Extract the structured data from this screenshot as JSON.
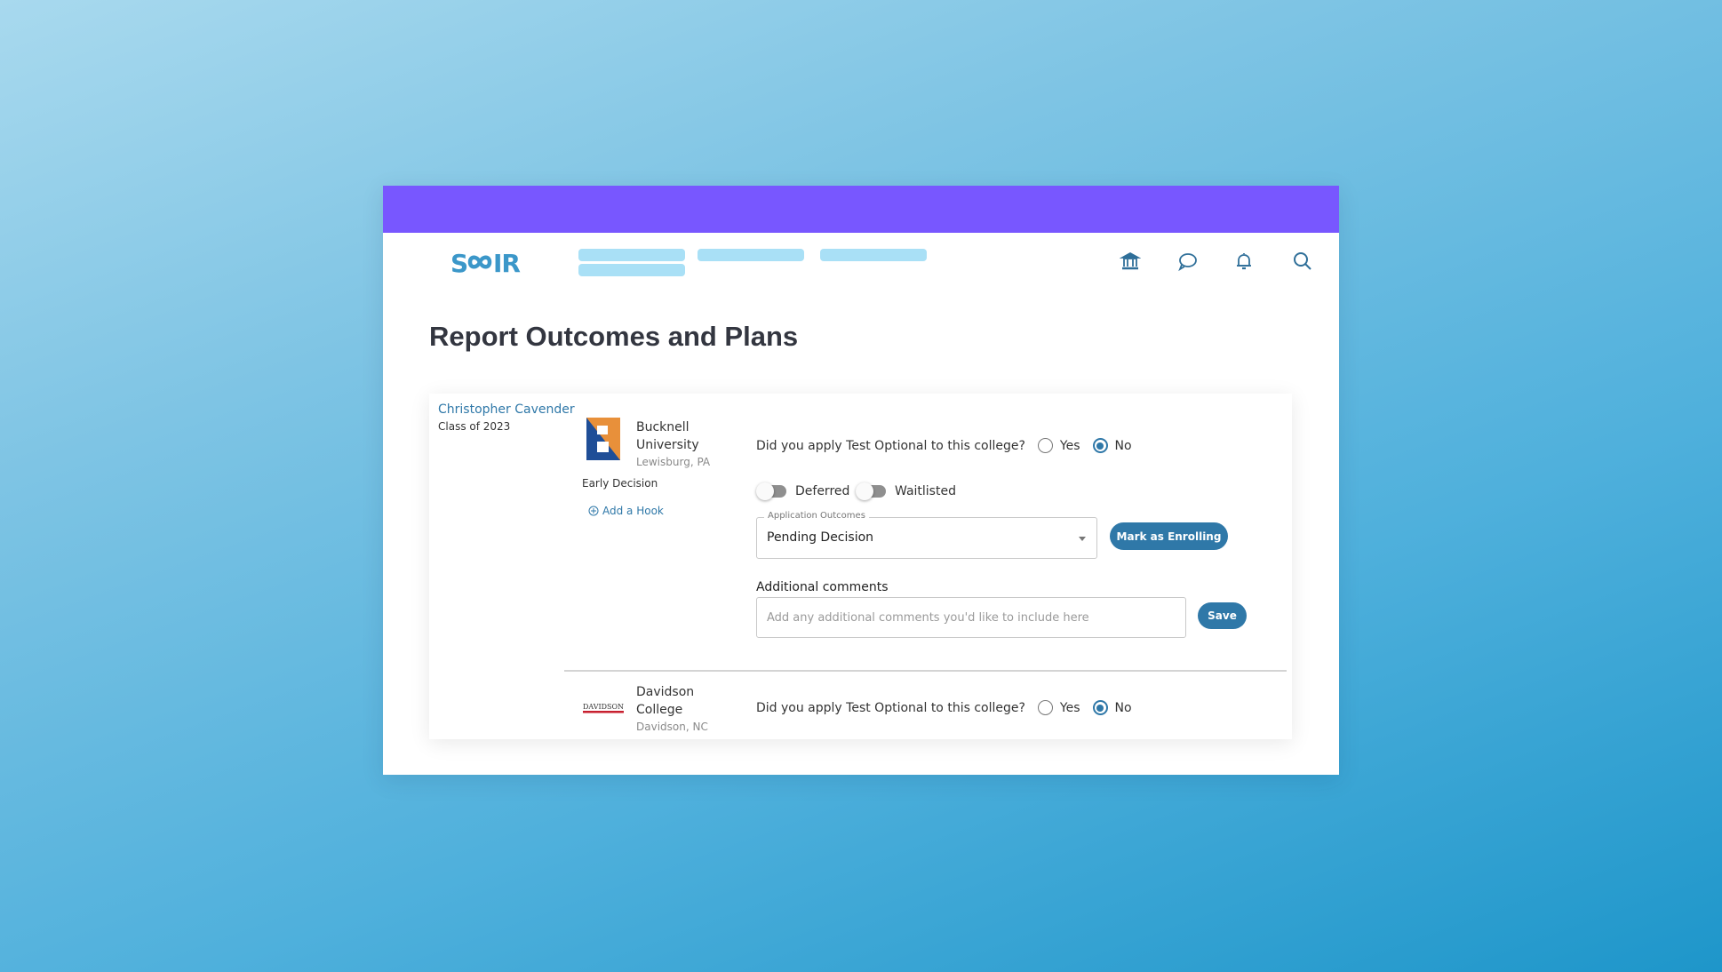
{
  "colors": {
    "topbar": "#7857ff",
    "brand": "#3b97c9",
    "primary_button": "#2f78a8",
    "link": "#2f78a8",
    "nav_placeholder": "#a9e0f6",
    "bucknell_orange": "#e8903a",
    "bucknell_blue": "#1f4e97",
    "davidson_red": "#c8202f"
  },
  "header": {
    "logo_text": "SCOIR",
    "nav_icons": [
      "institution-icon",
      "chat-icon",
      "bell-icon",
      "search-icon"
    ]
  },
  "page": {
    "title": "Report Outcomes and Plans"
  },
  "student": {
    "name": "Christopher Cavender",
    "class": "Class of 2023"
  },
  "applications": [
    {
      "school_name_line1": "Bucknell",
      "school_name_line2": "University",
      "location": "Lewisburg, PA",
      "decision_type": "Early Decision",
      "add_hook_label": "Add a Hook",
      "test_optional_question": "Did you apply Test Optional to this college?",
      "yes_label": "Yes",
      "no_label": "No",
      "test_optional_value": "No",
      "deferred_label": "Deferred",
      "deferred_on": false,
      "waitlisted_label": "Waitlisted",
      "waitlisted_on": false,
      "outcome_label": "Application Outcomes",
      "outcome_value": "Pending Decision",
      "mark_enrolling_label": "Mark as Enrolling",
      "comments_label": "Additional comments",
      "comments_placeholder": "Add any additional comments you'd like to include here",
      "comments_value": "",
      "save_label": "Save"
    },
    {
      "school_name_line1": "Davidson",
      "school_name_line2": "College",
      "location": "Davidson, NC",
      "logo_text": "DAVIDSON",
      "test_optional_question": "Did you apply Test Optional to this college?",
      "yes_label": "Yes",
      "no_label": "No",
      "test_optional_value": "No"
    }
  ]
}
